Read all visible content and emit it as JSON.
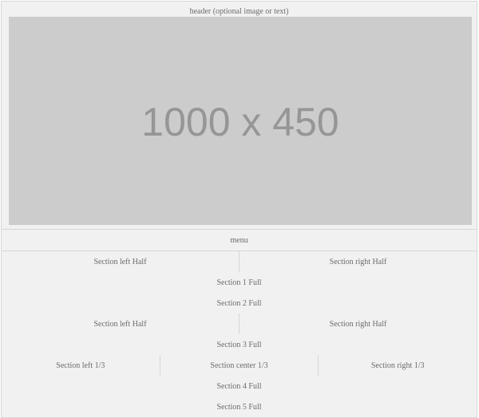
{
  "header": {
    "caption": "header (optional image or text)",
    "placeholder": "1000 x 450"
  },
  "menu": {
    "label": "menu"
  },
  "rows": [
    [
      "Section left Half",
      "Section right Half"
    ],
    [
      "Section 1 Full"
    ],
    [
      "Section 2 Full"
    ],
    [
      "Section left Half",
      "Section right Half"
    ],
    [
      "Section 3 Full"
    ],
    [
      "Section left 1/3",
      "Section center 1/3",
      "Section right 1/3"
    ],
    [
      "Section 4 Full"
    ],
    [
      "Section 5 Full"
    ]
  ]
}
